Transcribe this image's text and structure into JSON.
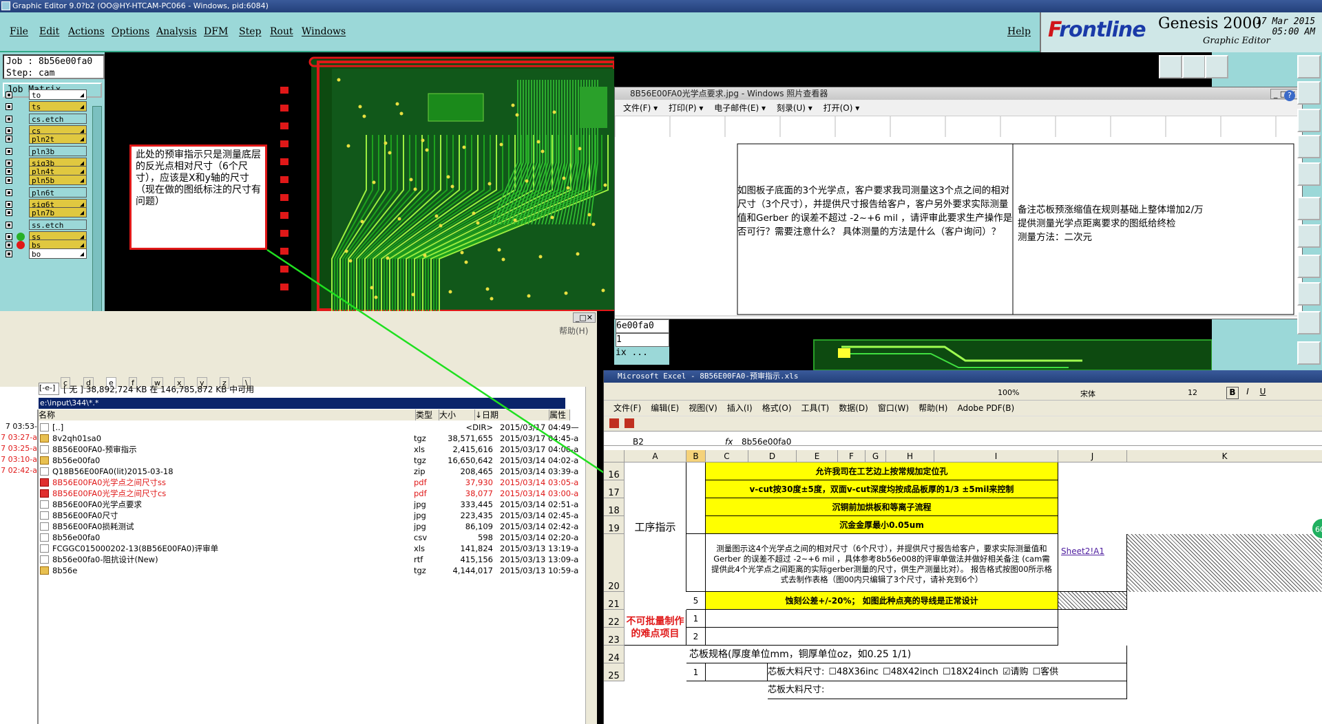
{
  "genesis": {
    "title": "Graphic Editor 9.0?b2 (OO@HY-HTCAM-PC066 - Windows, pid:6084)",
    "menu": [
      "File",
      "Edit",
      "Actions",
      "Options",
      "Analysis",
      "DFM",
      "Step",
      "Rout",
      "Windows"
    ],
    "help": "Help",
    "brand_front": "F",
    "brand_rest": "rontline",
    "product": "Genesis 2000",
    "subtitle": "Graphic Editor",
    "date": "17 Mar 2015",
    "time": "05:00 AM",
    "job_line": "Job : 8b56e00fa0",
    "step_line": "Step: cam",
    "job_matrix": "Job Matrix ...",
    "layers": [
      {
        "name": "to",
        "color": "#ffffff",
        "dot": ""
      },
      {
        "name": "ts",
        "color": "#e0c840",
        "dot": ""
      },
      {
        "name": "cs.etch",
        "color": "#9bd8d8",
        "dot": ""
      },
      {
        "name": "cs",
        "color": "#e0c840",
        "dot": ""
      },
      {
        "name": "pln2t",
        "color": "#e0c840",
        "dot": ""
      },
      {
        "name": "pln3b",
        "color": "#9bd8d8",
        "dot": ""
      },
      {
        "name": "sig3b",
        "color": "#e0c840",
        "dot": ""
      },
      {
        "name": "pln4t",
        "color": "#e0c840",
        "dot": ""
      },
      {
        "name": "pln5b",
        "color": "#e0c840",
        "dot": ""
      },
      {
        "name": "pln6t",
        "color": "#9bd8d8",
        "dot": ""
      },
      {
        "name": "sig6t",
        "color": "#e0c840",
        "dot": ""
      },
      {
        "name": "pln7b",
        "color": "#e0c840",
        "dot": ""
      },
      {
        "name": "ss.etch",
        "color": "#9bd8d8",
        "dot": ""
      },
      {
        "name": "ss",
        "color": "#e0c840",
        "dot": "#28b028"
      },
      {
        "name": "bs",
        "color": "#e0c840",
        "dot": "#e01818"
      },
      {
        "name": "bo",
        "color": "#ffffff",
        "dot": ""
      }
    ],
    "callout": "此处的预审指示只是测量底层的反光点相对尺寸（6个尺寸），应该是X和y轴的尺寸（现在做的图纸标注的尺寸有问题）",
    "mini_job": "6e00fa0",
    "mini_step": "1",
    "mini_matrix": "ix ..."
  },
  "photo_viewer": {
    "title": "8B56E00FA0光学点要求.jpg - Windows 照片查看器",
    "menu": [
      "文件(F)",
      "打印(P)",
      "电子邮件(E)",
      "刻录(U)",
      "打开(O)"
    ],
    "cell1": "如图板子底面的3个光学点，客户要求我司测量这3个点之间的相对尺寸（3个尺寸），并提供尺寸报告给客户，客户另外要求实际测量值和Gerber 的误差不超过 -2~+6 mil ，请评审此要求生产操作是否可行？需要注意什么？ 具体测量的方法是什么（客户询问）？",
    "cell2": "备注芯板预涨缩值在规则基础上整体增加2/万\n提供测量光学点距离要求的图纸给终检\n测量方法：二次元"
  },
  "commander": {
    "help": "帮助(H)",
    "drives": [
      "c",
      "d",
      "e",
      "f",
      "w",
      "x",
      "y",
      "z",
      "\\"
    ],
    "drive_sel": "[-e-]",
    "info": "[ 无 ]  38,892,724 KB 在 146,785,872 KB 中可用",
    "path": "e:\\input\\344\\*.*",
    "headers": [
      "名称",
      "类型",
      "大小",
      "↓日期",
      "属性"
    ],
    "left_times": [
      {
        "t": "7 03:53-",
        "red": false
      },
      {
        "t": "7 03:27-a",
        "red": true
      },
      {
        "t": "7 03:25-a",
        "red": true
      },
      {
        "t": "7 03:10-a",
        "red": true
      },
      {
        "t": "7 02:42-a",
        "red": true
      }
    ],
    "files": [
      {
        "name": "[..]",
        "type": "",
        "size": "<DIR>",
        "date": "2015/03/17 04:49—",
        "red": false
      },
      {
        "name": "8v2qh01sa0",
        "type": "tgz",
        "size": "38,571,655",
        "date": "2015/03/17 04:45-a",
        "red": false
      },
      {
        "name": "8B56E00FA0-预审指示",
        "type": "xls",
        "size": "2,415,616",
        "date": "2015/03/17 04:06-a",
        "red": false
      },
      {
        "name": "8b56e00fa0",
        "type": "tgz",
        "size": "16,650,642",
        "date": "2015/03/14 04:02-a",
        "red": false
      },
      {
        "name": "Q18B56E00FA0(lit)2015-03-18",
        "type": "zip",
        "size": "208,465",
        "date": "2015/03/14 03:39-a",
        "red": false
      },
      {
        "name": "8B56E00FA0光学点之间尺寸ss",
        "type": "pdf",
        "size": "37,930",
        "date": "2015/03/14 03:05-a",
        "red": true
      },
      {
        "name": "8B56E00FA0光学点之间尺寸cs",
        "type": "pdf",
        "size": "38,077",
        "date": "2015/03/14 03:00-a",
        "red": true
      },
      {
        "name": "8B56E00FA0光学点要求",
        "type": "jpg",
        "size": "333,445",
        "date": "2015/03/14 02:51-a",
        "red": false
      },
      {
        "name": "8B56E00FA0尺寸",
        "type": "jpg",
        "size": "223,435",
        "date": "2015/03/14 02:45-a",
        "red": false
      },
      {
        "name": "8B56E00FA0损耗测试",
        "type": "jpg",
        "size": "86,109",
        "date": "2015/03/14 02:42-a",
        "red": false
      },
      {
        "name": "8b56e00fa0",
        "type": "csv",
        "size": "598",
        "date": "2015/03/14 02:20-a",
        "red": false
      },
      {
        "name": "FCGGC015000202-13(8B56E00FA0)评审单",
        "type": "xls",
        "size": "141,824",
        "date": "2015/03/13 13:19-a",
        "red": false
      },
      {
        "name": "8b56e00fa0-阻抗设计(New)",
        "type": "rtf",
        "size": "415,156",
        "date": "2015/03/13 13:09-a",
        "red": false
      },
      {
        "name": "8b56e",
        "type": "tgz",
        "size": "4,144,017",
        "date": "2015/03/13 10:59-a",
        "red": false
      }
    ]
  },
  "excel": {
    "title": "Microsoft Excel - 8B56E00FA0-预审指示.xls",
    "zoom": "100%",
    "font": "宋体",
    "size": "12",
    "menu": [
      "文件(F)",
      "编辑(E)",
      "视图(V)",
      "插入(I)",
      "格式(O)",
      "工具(T)",
      "数据(D)",
      "窗口(W)",
      "帮助(H)",
      "Adobe PDF(B)"
    ],
    "namebox": "B2",
    "formula": "8b56e00fa0",
    "cols": [
      "A",
      "B",
      "C",
      "D",
      "E",
      "F",
      "G",
      "H",
      "I",
      "J",
      "K"
    ],
    "rows": [
      "16",
      "17",
      "18",
      "19",
      "20",
      "21",
      "22",
      "23",
      "24",
      "25"
    ],
    "section1": "工序指示",
    "section2": "不可批量制作的难点项目",
    "y16": "允许我司在工艺边上按常规加定位孔",
    "y17": "v-cut按30度±5度，双面v-cut深度均按成品板厚的1/3  ±5mil来控制",
    "y18": "沉铜前加烘板和等离子流程",
    "y19": "沉金金厚最小0.05um",
    "r20": "测量图示这4个光学点之间的相对尺寸（6个尺寸），并提供尺寸报告给客户，要求实际测量值和Gerber 的误差不超过  -2~+6 mil ，具体参考8b56e008的评审单做法并做好相关备注    (cam需提供此4个光学点之间距离的实际gerber测量的尺寸，供生产测量比对）。  报告格式按图00所示格式去制作表格（图00内只编辑了3个尺寸，请补充到6个）",
    "r20link": "Sheet2!A1",
    "r21b": "5",
    "r21": "蚀刻公差+/-20%；     如图此种点亮的导线是正常设计",
    "r22b": "1",
    "r23b": "2",
    "r24": "芯板规格(厚度单位mm，铜厚单位oz，如0.25 1/1)",
    "r25b": "1",
    "r25": "芯板大料尺寸:",
    "opt1": "48X36inc",
    "opt2": "48X42inch",
    "opt3": "18X24inch",
    "opt4": "请购",
    "opt5": "客供",
    "r26": "芯板大料尺寸:"
  },
  "badge": "60"
}
